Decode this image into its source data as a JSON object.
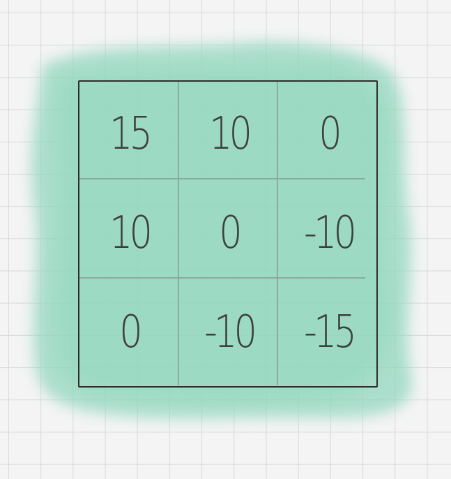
{
  "colors": {
    "paper": "#f4f4f4",
    "grid_line": "#d9d9d9",
    "wash": "#8fd6bd",
    "frame": "#2e2e2e",
    "digits": "#3d3f3f"
  },
  "matrix": {
    "rows": [
      [
        "15",
        "10",
        "0"
      ],
      [
        "10",
        "0",
        "-10"
      ],
      [
        "0",
        "-10",
        "-15"
      ]
    ]
  }
}
